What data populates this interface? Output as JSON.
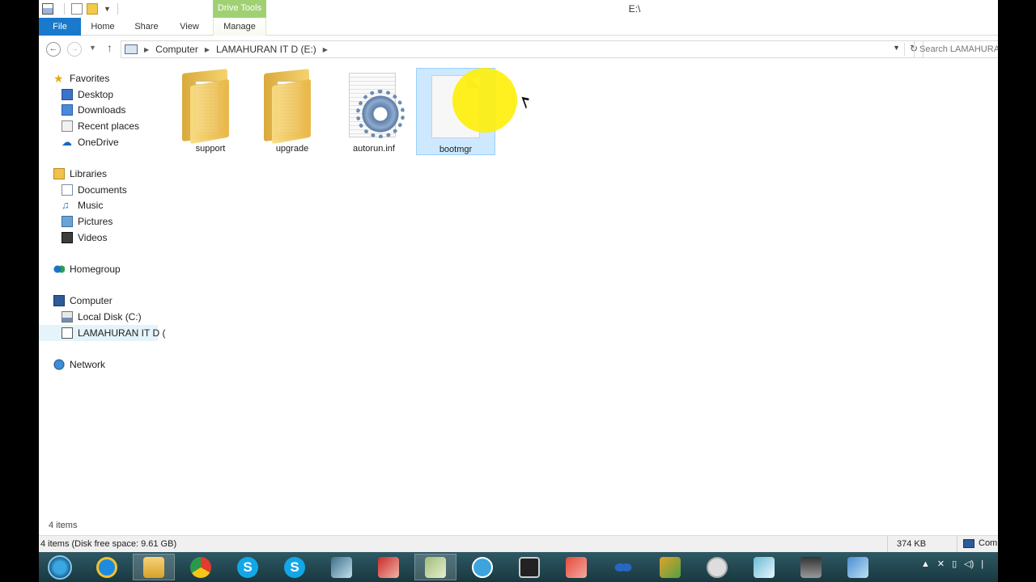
{
  "titlebar": {
    "window_title": "E:\\",
    "contextual_group": "Drive Tools"
  },
  "ribbon": {
    "tabs": [
      "File",
      "Home",
      "Share",
      "View",
      "Manage"
    ]
  },
  "address": {
    "crumbs": [
      "Computer",
      "LAMAHURAN IT D (E:)"
    ],
    "search_placeholder": "Search LAMAHURAN"
  },
  "navpane": {
    "favorites": "Favorites",
    "desktop": "Desktop",
    "downloads": "Downloads",
    "recent": "Recent places",
    "onedrive": "OneDrive",
    "libraries": "Libraries",
    "documents": "Documents",
    "music": "Music",
    "pictures": "Pictures",
    "videos": "Videos",
    "homegroup": "Homegroup",
    "computer": "Computer",
    "local_disk": "Local Disk (C:)",
    "lamahuran": "LAMAHURAN IT D (",
    "network": "Network"
  },
  "files": [
    {
      "name": "support",
      "type": "folder"
    },
    {
      "name": "upgrade",
      "type": "folder"
    },
    {
      "name": "autorun.inf",
      "type": "settings-file"
    },
    {
      "name": "bootmgr",
      "type": "file",
      "selected": true
    }
  ],
  "status": {
    "item_count": "4 items",
    "details": "4 items (Disk free space: 9.61 GB)",
    "size": "374 KB",
    "computer": "Com"
  },
  "taskbar": {
    "icons": [
      "start-orb-icon",
      "internet-explorer-icon",
      "file-explorer-icon",
      "chrome-icon",
      "skype-for-business-icon",
      "skype-icon",
      "app-icon",
      "app-icon",
      "app-icon",
      "media-player-icon",
      "camera-icon",
      "app-icon",
      "app-icon",
      "app-icon",
      "app-icon",
      "app-icon",
      "app-icon",
      "app-icon"
    ],
    "skype_glyph": "S",
    "tray_glyphs": [
      "▲",
      "✕",
      "▯",
      "◁)",
      "|"
    ]
  },
  "colors": {
    "file_tab": "#1979ca",
    "contextual_tab": "#9fd173",
    "selection": "#cde8ff",
    "cursor_highlight": "#ffee00"
  }
}
